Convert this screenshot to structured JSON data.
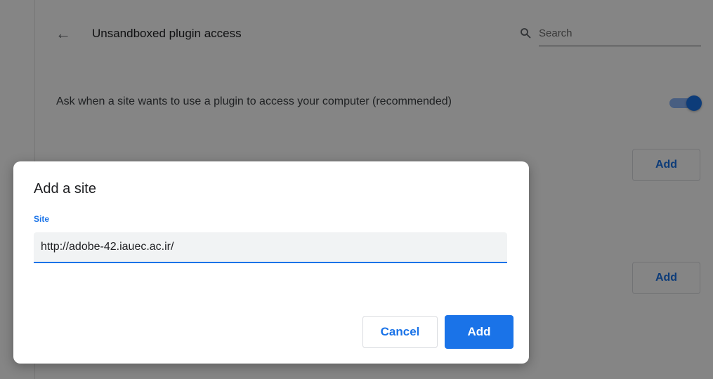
{
  "header": {
    "back_icon": "arrow-left-icon",
    "title": "Unsandboxed plugin access"
  },
  "search": {
    "icon": "search-icon",
    "placeholder": "Search",
    "value": ""
  },
  "settings": {
    "ask_label": "Ask when a site wants to use a plugin to access your computer (recommended)",
    "ask_toggle_on": true,
    "sections": [
      {
        "add_label": "Add"
      },
      {
        "add_label": "Add"
      }
    ]
  },
  "dialog": {
    "title": "Add a site",
    "site_label": "Site",
    "site_value": "http://adobe-42.iauec.ac.ir/",
    "cancel_label": "Cancel",
    "add_label": "Add"
  },
  "colors": {
    "accent": "#1a73e8",
    "scrim": "#000000"
  }
}
